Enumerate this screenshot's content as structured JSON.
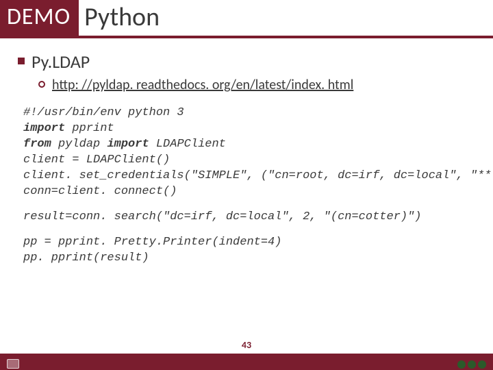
{
  "header": {
    "badge": "DEMO",
    "title": "Python"
  },
  "bullets": {
    "level1": "Py.LDAP",
    "level2": "http: //pyldap. readthedocs. org/en/latest/index. html"
  },
  "code": {
    "l1": "#!/usr/bin/env python 3",
    "l2a": "import",
    "l2b": " pprint",
    "l3a": "from",
    "l3b": " pyldap ",
    "l3c": "import",
    "l3d": " LDAPClient",
    "l4": "client = LDAPClient()",
    "l5": "client. set_credentials(\"SIMPLE\", (\"cn=root, dc=irf, dc=local\", \"**\"))",
    "l6": "conn=client. connect()",
    "l7": "result=conn. search(\"dc=irf, dc=local\", 2, \"(cn=cotter)\")",
    "l8": "pp = pprint. Pretty.Printer(indent=4)",
    "l9": "pp. pprint(result)"
  },
  "page_number": "43"
}
